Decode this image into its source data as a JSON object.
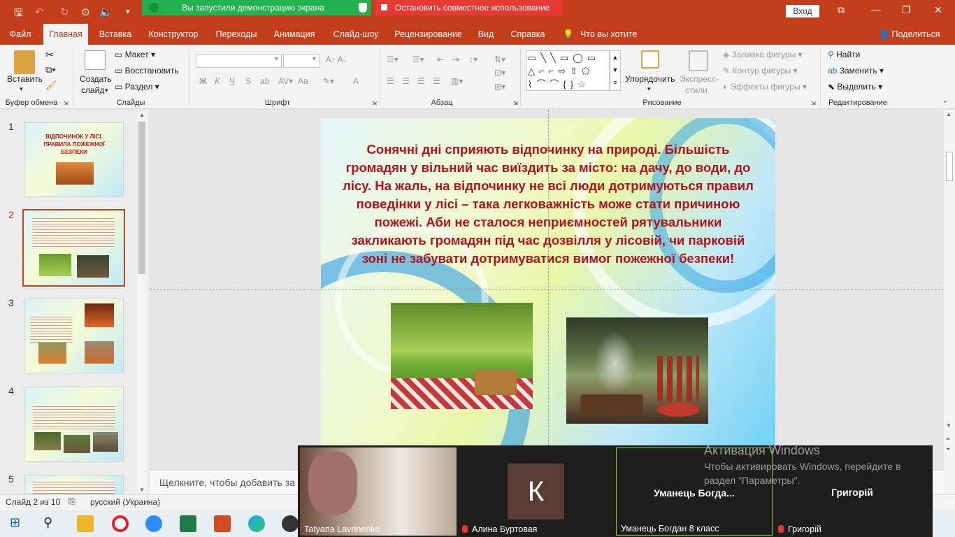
{
  "titlebar": {
    "share_status": "Вы запустили демонстрацию экрана",
    "stop_share": "Остановить совместное использование",
    "login": "Вход"
  },
  "tabs": [
    "Файл",
    "Главная",
    "Вставка",
    "Конструктор",
    "Переходы",
    "Анимация",
    "Слайд-шоу",
    "Рецензирование",
    "Вид",
    "Справка"
  ],
  "tell_me": "Что вы хотите сделать?",
  "share_btn": "Поделиться",
  "ribbon": {
    "paste": "Вставить",
    "clipboard": "Буфер обмена",
    "create_slide_1": "Создать",
    "create_slide_2": "слайд",
    "layout": "Макет",
    "reset": "Восстановить",
    "section": "Раздел",
    "slides": "Слайды",
    "font": "Шрифт",
    "font_bold": "Ж",
    "font_italic": "К",
    "font_underline": "Ч",
    "font_strike": "S",
    "font_spacing": "ab",
    "font_case": "Аа",
    "font_color": "A",
    "paragraph": "Абзац",
    "arrange": "Упорядочить",
    "styles_1": "Экспресс-",
    "styles_2": "стили",
    "fill": "Заливка фигуры",
    "outline": "Контур фигуры",
    "effects": "Эффекты фигуры",
    "drawing": "Рисование",
    "find": "Найти",
    "replace": "Заменить",
    "select": "Выделить",
    "editing": "Редактирование"
  },
  "thumbnails": {
    "nums": [
      "1",
      "2",
      "3",
      "4",
      "5"
    ],
    "t1_title": "ВІДПОЧИНОК У ЛІСІ. ПРАВИЛА ПОЖЕЖНОЇ БЕЗПЕКИ"
  },
  "slide": {
    "text": "Сонячні дні сприяють відпочинку на природі. Більшість громадян у вільний час виїздить за місто: на дачу, до води, до лісу. На жаль, на відпочинку не всі люди дотримуються правил поведінки у лісі – така легковажність може стати причиною пожежі. Аби не сталося неприємностей рятувальники закликають громадян під час дозвілля у лісовій, чи парковій зоні не забувати дотримуватися вимог пожежної безпеки!"
  },
  "notes_placeholder": "Щелкните, чтобы добавить за",
  "status": {
    "slide_info": "Слайд 2 из 10",
    "language": "русский (Украина)"
  },
  "zoom": {
    "p1": "Tatyana Lavrinenko",
    "p2": "Алина Буртовая",
    "p2_initial": "К",
    "p3_center": "Уманець  Богда...",
    "p3": "Уманець Богдан 8 класс",
    "p4_center": "Григорій",
    "p4": "Григорій"
  },
  "activation": {
    "title": "Активация Windows",
    "desc": "Чтобы активировать Windows, перейдите в раздел \"Параметры\"."
  },
  "colors": {
    "accent": "#c43e1c",
    "slide_text": "#b0141b",
    "share_green": "#23b04f",
    "share_red": "#e53935"
  }
}
